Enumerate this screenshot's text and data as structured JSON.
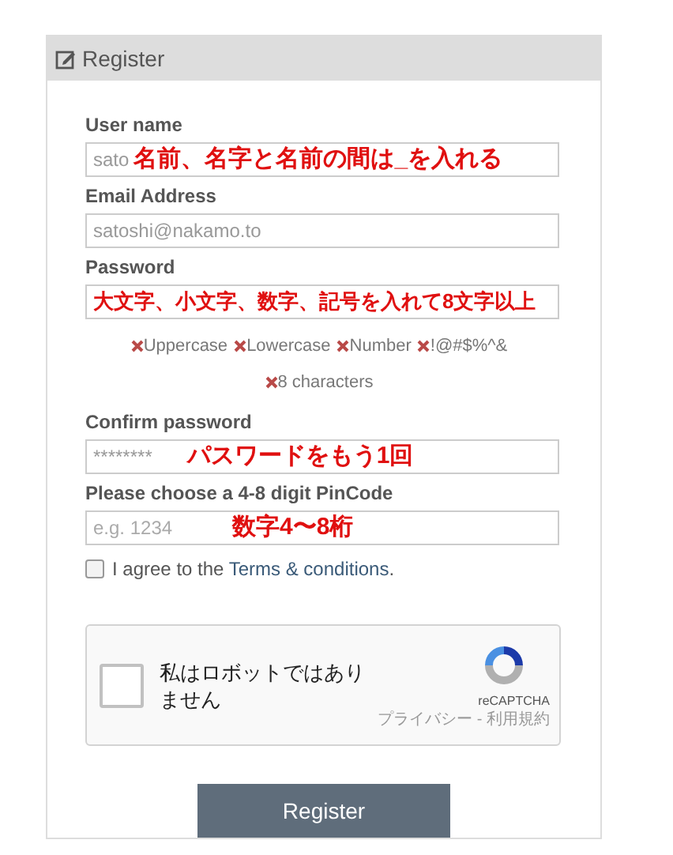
{
  "panel": {
    "title": "Register"
  },
  "fields": [
    {
      "label": "User name",
      "value": "sato",
      "annotation": "名前、名字と名前の間は_を入れる",
      "kind": "text"
    },
    {
      "label": "Email Address",
      "value": "satoshi@nakamo.to",
      "kind": "text"
    },
    {
      "label": "Password",
      "annotation": "大文字、小文字、数字、記号を入れて8文字以上",
      "kind": "wide"
    },
    {
      "kind": "rules",
      "rules": [
        {
          "text": "Uppercase",
          "met": false
        },
        {
          "text": "Lowercase",
          "met": false
        },
        {
          "text": "Number",
          "met": false
        },
        {
          "text": "!@#$%^&",
          "met": false
        },
        {
          "text": "8 characters",
          "met": false
        }
      ]
    },
    {
      "label": "Confirm password",
      "value": "********",
      "annotation": "パスワードをもう1回",
      "kind": "text"
    },
    {
      "label": "Please choose a 4-8 digit PinCode",
      "placeholder": "e.g. 1234",
      "annotation": "数字4〜8桁",
      "kind": "text"
    }
  ],
  "agree": {
    "checked": false,
    "prefix": "I agree to the",
    "link": "Terms & conditions",
    "suffix": "."
  },
  "captcha": {
    "checked": false,
    "label": "私はロボットではありません",
    "brand": "reCAPTCHA",
    "footer": "プライバシー - 利用規約"
  },
  "submit": "Register"
}
